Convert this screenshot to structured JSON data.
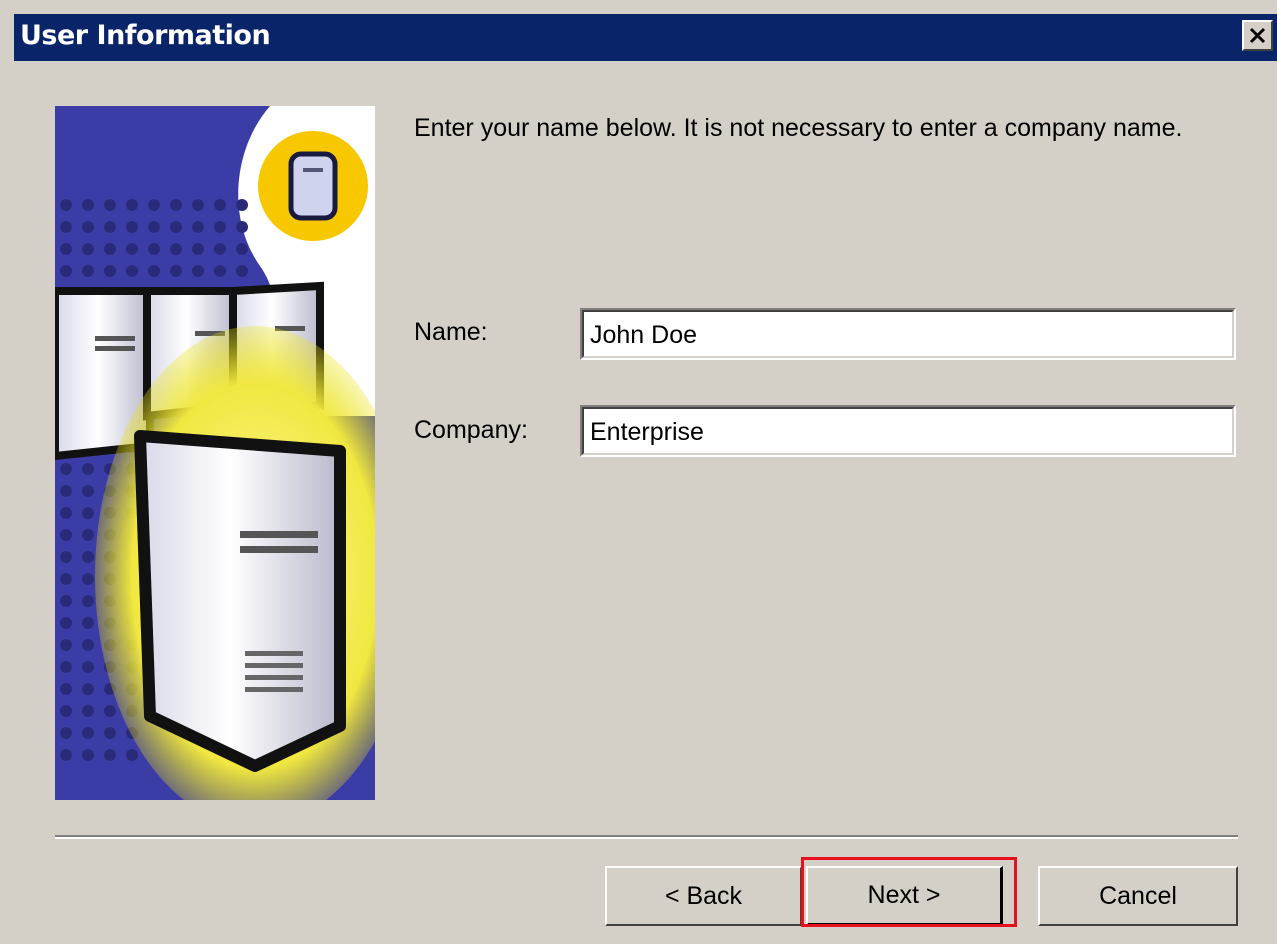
{
  "window": {
    "title": "User Information",
    "close_glyph": "✕"
  },
  "instruction": "Enter your name below.  It is not necessary to enter a company name.",
  "form": {
    "name_label": "Name:",
    "name_value": "John Doe",
    "company_label": "Company:",
    "company_value": "Enterprise"
  },
  "buttons": {
    "back": "< Back",
    "next": "Next >",
    "cancel": "Cancel"
  },
  "colors": {
    "titlebar": "#0a246a",
    "dialog_bg": "#d4d0c8",
    "highlight": "#e8101e",
    "art_blue": "#3a3aa0",
    "art_yellow": "#f7d200"
  },
  "icons": [
    "close-icon",
    "server-illustration",
    "server-badge-icon"
  ]
}
